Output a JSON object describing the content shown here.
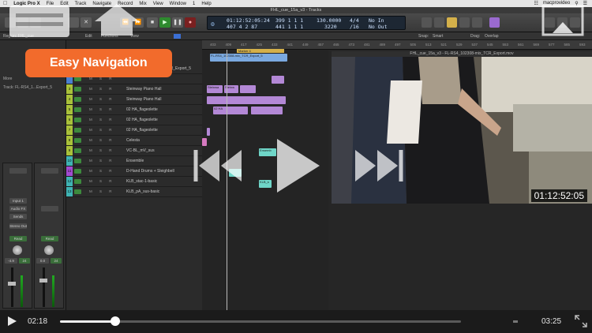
{
  "menubar": {
    "app": "Logic Pro X",
    "items": [
      "File",
      "Edit",
      "Track",
      "Navigate",
      "Record",
      "Mix",
      "View",
      "Window",
      "1",
      "Help"
    ],
    "username": "macprovideo"
  },
  "window": {
    "title": "FHL_cue_15a_v3 - Tracks"
  },
  "lcd": {
    "timecode_top": "01:12:52:05:24",
    "bars_top": "399  1  1  1",
    "tempo": "130.0000",
    "signature": "4/4",
    "in": "No In",
    "timecode_bottom": "407  4  2  87",
    "bars_bottom": "441  1  1  1",
    "division": "3220",
    "div_value": "/16",
    "out": "No Out"
  },
  "trackbar": {
    "region_label": "Region: FHL_cue",
    "edit": "Edit",
    "functions": "Functions",
    "view": "View",
    "snap_label": "Snap:",
    "snap_value": "Smart",
    "drag_label": "Drag:",
    "drag_value": "Overlap"
  },
  "inspector": {
    "more": "More",
    "track_label": "Track: FL-RS4_1...Export_5",
    "input": "Input 1",
    "audio": "Audio FX",
    "send": "Sends",
    "stereo_out": "Stereo Out",
    "read_l": "Read",
    "read_r": "Read",
    "vol_l": "-4.9",
    "pan_l": "24",
    "vol_r": "0.0",
    "pan_r": "24"
  },
  "tracks": [
    {
      "num": "",
      "name": "FL-RS4_102308-mix_TCR_Export_5",
      "color": "#4a7fd0"
    },
    {
      "num": "",
      "name": "",
      "color": "#4a7fd0"
    },
    {
      "num": "3",
      "name": "Steinway Piano Hall",
      "color": "#a9c13a"
    },
    {
      "num": "4",
      "name": "Steinway Piano Hall",
      "color": "#a9c13a"
    },
    {
      "num": "5",
      "name": "02 HA_flageolette",
      "color": "#a9c13a"
    },
    {
      "num": "6",
      "name": "02 HA_flageolette",
      "color": "#a9c13a"
    },
    {
      "num": "7",
      "name": "02 HA_flageolette",
      "color": "#a9c13a"
    },
    {
      "num": "8",
      "name": "Celesta",
      "color": "#a9c13a"
    },
    {
      "num": "9",
      "name": "VC-BL_mV_sus",
      "color": "#a9c13a"
    },
    {
      "num": "10",
      "name": "Ensemble",
      "color": "#3fb3b3"
    },
    {
      "num": "11",
      "name": "D-Hand Drums + Sleighbell",
      "color": "#a24bd0"
    },
    {
      "num": "12",
      "name": "KLB_stac-1-basic",
      "color": "#3fb3b3"
    },
    {
      "num": "13",
      "name": "KLB_pA_sus-basic",
      "color": "#3fb3b3"
    }
  ],
  "ruler": {
    "marks": [
      "403",
      "409",
      "417",
      "425",
      "433",
      "441",
      "449",
      "457",
      "465",
      "473",
      "481",
      "489",
      "497",
      "505",
      "513",
      "521",
      "529",
      "537",
      "545",
      "553",
      "561",
      "569",
      "577",
      "585",
      "593"
    ],
    "marker": "Marker 4"
  },
  "regions": {
    "r1": "FL-RS4_102308-mix_TCR_Export_5",
    "r2": "Steinwa",
    "r3": "Steinw",
    "r4": "02 HA",
    "r5": "Ensemb",
    "r6": "KLB_s"
  },
  "video": {
    "title": "FHL_cue_15a_v3 - FL-RS4_102308-mix_TCR_Export.mov",
    "timecode": "01:12:52:05"
  },
  "overlay": {
    "callout": "Easy Navigation"
  },
  "player": {
    "elapsed": "02:18",
    "duration": "03:25",
    "progress": 0.138
  }
}
